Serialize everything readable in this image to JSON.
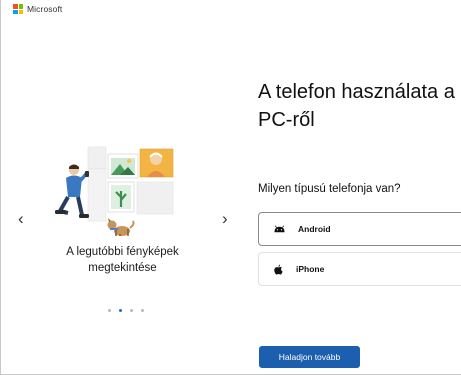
{
  "brand": {
    "name": "Microsoft",
    "logo_colors": [
      "#f25022",
      "#7fba00",
      "#00a4ef",
      "#ffb900"
    ]
  },
  "carousel": {
    "caption_line1": "A legutóbbi fényképek",
    "caption_line2": "megtekintése",
    "prev_glyph": "‹",
    "next_glyph": "›",
    "slide_count": 4,
    "active_index": 1
  },
  "main": {
    "title_line1": "A telefon használata a",
    "title_line2": "PC-ről",
    "question": "Milyen típusú telefonja van?",
    "options": [
      {
        "label": "Android",
        "icon": "android-icon",
        "selected": true
      },
      {
        "label": "iPhone",
        "icon": "apple-icon",
        "selected": false
      }
    ],
    "continue_label": "Haladjon tovább"
  },
  "colors": {
    "accent": "#1b5fae",
    "dot_active": "#1f6dbf",
    "dot_inactive": "#b9b9b9"
  }
}
